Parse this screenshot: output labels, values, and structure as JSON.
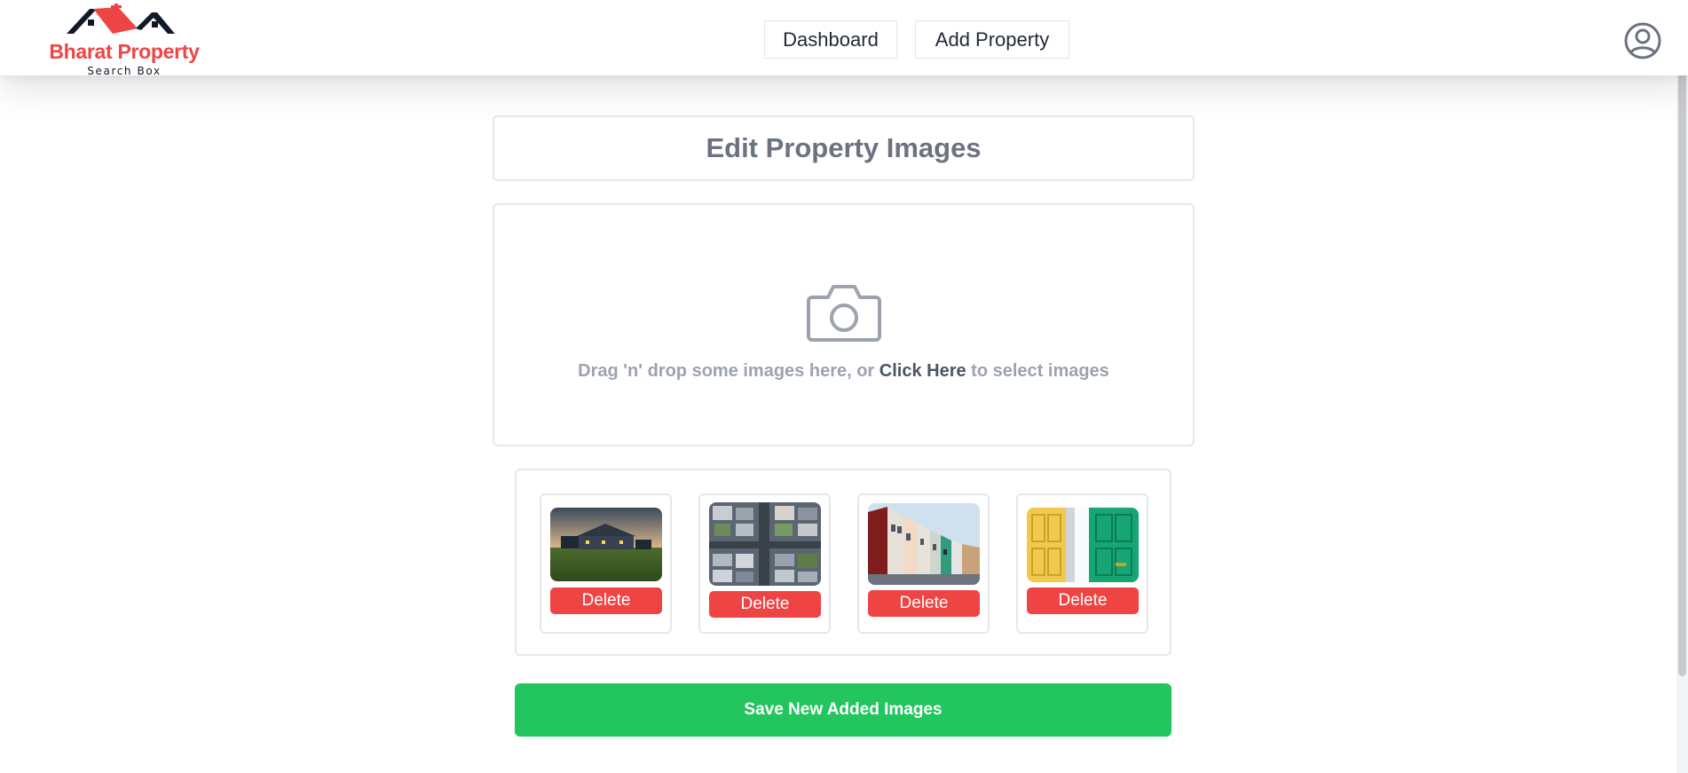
{
  "header": {
    "logo": {
      "title": "Bharat Property",
      "subtitle": "Search Box",
      "brand_color": "#ef4444"
    },
    "nav": {
      "dashboard_label": "Dashboard",
      "add_property_label": "Add Property"
    },
    "user_icon": "user-circle-icon"
  },
  "main": {
    "title": "Edit Property Images",
    "dropzone": {
      "icon": "camera-icon",
      "text_before": "Drag 'n' drop some images here, or ",
      "link_text": "Click Here",
      "text_after": " to select images"
    },
    "images": [
      {
        "subject": "farmhouse-at-dusk",
        "delete_label": "Delete"
      },
      {
        "subject": "aerial-neighborhood",
        "delete_label": "Delete"
      },
      {
        "subject": "colorful-townhouses",
        "delete_label": "Delete"
      },
      {
        "subject": "yellow-and-green-doors",
        "delete_label": "Delete"
      }
    ],
    "save_label": "Save New Added Images"
  },
  "colors": {
    "danger": "#ef4444",
    "success": "#22c55e",
    "muted_text": "#9ca3af",
    "title_text": "#6b7280"
  }
}
